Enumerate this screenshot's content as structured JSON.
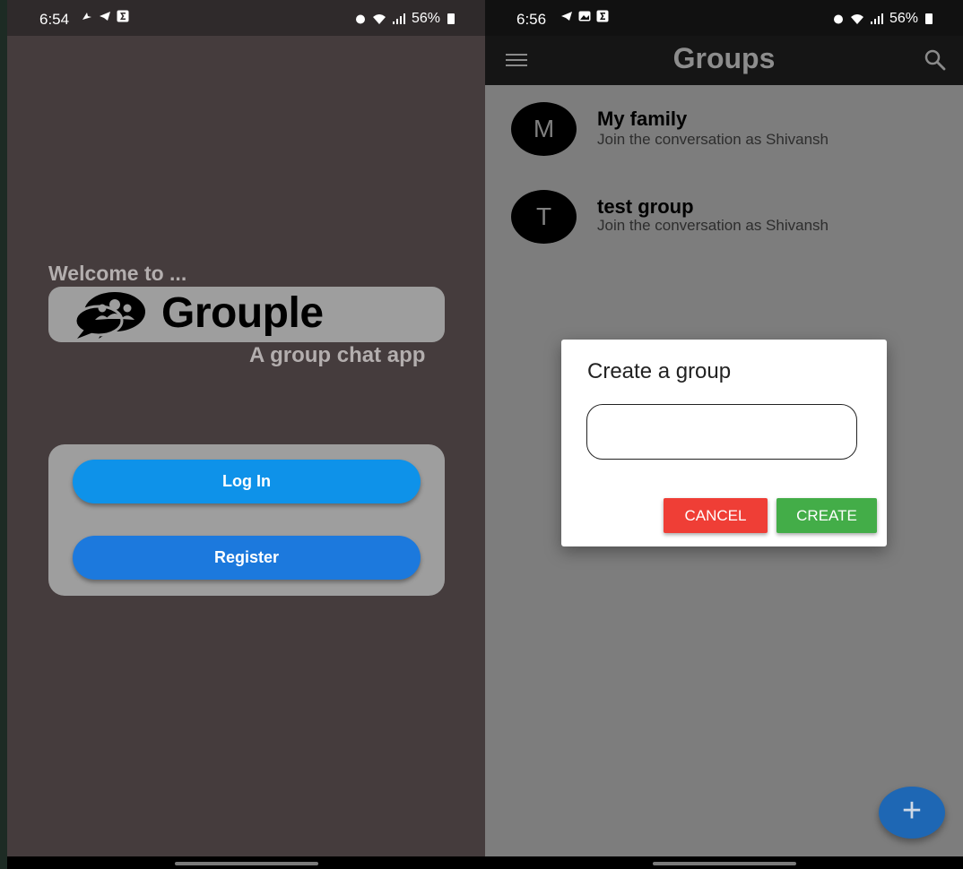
{
  "left_screen": {
    "status": {
      "time": "6:54",
      "battery": "56%"
    },
    "welcome": "Welcome to ...",
    "app_name": "Grouple",
    "tagline": "A group chat app",
    "login_label": "Log In",
    "register_label": "Register"
  },
  "right_screen": {
    "status": {
      "time": "6:56",
      "battery": "56%"
    },
    "title": "Groups",
    "groups": [
      {
        "initial": "M",
        "name": "My family",
        "subtitle": "Join the conversation as Shivansh"
      },
      {
        "initial": "T",
        "name": "test group",
        "subtitle": "Join the conversation as Shivansh"
      }
    ],
    "dialog": {
      "title": "Create a group",
      "input_value": "",
      "cancel_label": "CANCEL",
      "create_label": "CREATE"
    },
    "fab_label": "+"
  },
  "colors": {
    "login": "#0e92e9",
    "register": "#1c79dd",
    "cancel": "#ef3e36",
    "create": "#43ad48",
    "fab": "#1e67b4"
  }
}
